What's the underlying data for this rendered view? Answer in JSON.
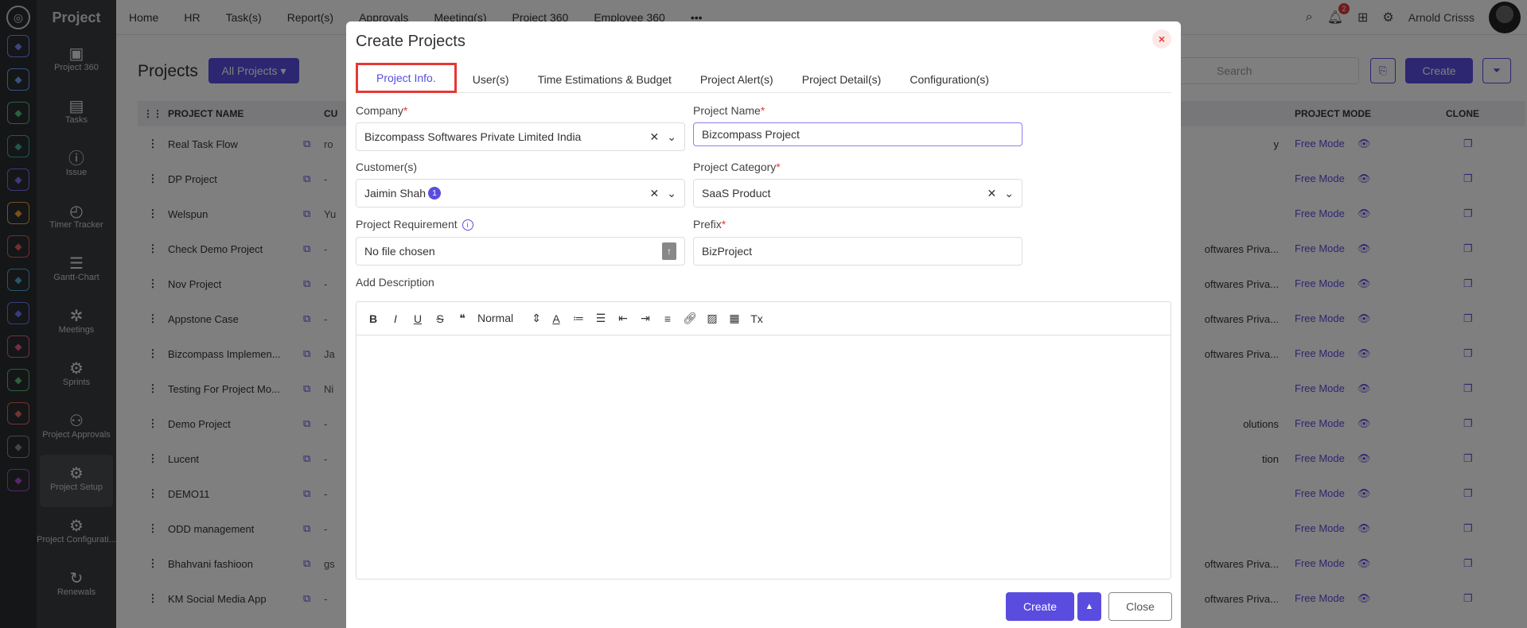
{
  "app": {
    "brand": "Project"
  },
  "rail_icons": [
    "compass-icon",
    "grid-icon",
    "pin-icon",
    "tree-icon",
    "chart-icon",
    "layers-icon",
    "people-icon",
    "target-icon",
    "calendar-icon",
    "hierarchy-icon",
    "screen-icon",
    "doc-icon",
    "spider-icon",
    "home-icon",
    "gear-icon"
  ],
  "sidebar": {
    "items": [
      {
        "label": "Project 360",
        "icon": "briefcase-icon",
        "glyph": "▣"
      },
      {
        "label": "Tasks",
        "icon": "clipboard-icon",
        "glyph": "▤"
      },
      {
        "label": "Issue",
        "icon": "alert-icon",
        "glyph": "ⓘ"
      },
      {
        "label": "Timer Tracker",
        "icon": "timer-icon",
        "glyph": "◴"
      },
      {
        "label": "Gantt-Chart",
        "icon": "gantt-icon",
        "glyph": "☰"
      },
      {
        "label": "Meetings",
        "icon": "meetings-icon",
        "glyph": "✲"
      },
      {
        "label": "Sprints",
        "icon": "sprints-icon",
        "glyph": "⚙"
      },
      {
        "label": "Project Approvals",
        "icon": "approvals-icon",
        "glyph": "⚇"
      },
      {
        "label": "Project Setup",
        "icon": "setup-icon",
        "glyph": "⚙"
      },
      {
        "label": "Project Configurati...",
        "icon": "config-icon",
        "glyph": "⚙"
      },
      {
        "label": "Renewals",
        "icon": "renew-icon",
        "glyph": "↻"
      }
    ]
  },
  "topnav": {
    "items": [
      "Home",
      "HR",
      "Task(s)",
      "Report(s)",
      "Approvals",
      "Meeting(s)",
      "Project 360",
      "Employee 360"
    ],
    "more": "•••",
    "notif_count": "2",
    "user": "Arnold Crisss"
  },
  "page": {
    "title": "Projects",
    "filter_button": "All Projects ▾",
    "search_placeholder": "Search",
    "create_label": "Create"
  },
  "table": {
    "headers": {
      "name": "PROJECT NAME",
      "cu": "CU",
      "mode": "PROJECT MODE",
      "clone": "CLONE"
    },
    "rows": [
      {
        "name": "Real Task Flow",
        "cust": "ro",
        "mid": "y",
        "mode": "Free Mode"
      },
      {
        "name": "DP Project",
        "cust": "-",
        "mid": "",
        "mode": "Free Mode"
      },
      {
        "name": "Welspun",
        "cust": "Yu",
        "mid": "",
        "mode": "Free Mode"
      },
      {
        "name": "Check Demo Project",
        "cust": "-",
        "mid": "oftwares Priva...",
        "mode": "Free Mode"
      },
      {
        "name": "Nov Project",
        "cust": "-",
        "mid": "oftwares Priva...",
        "mode": "Free Mode"
      },
      {
        "name": "Appstone Case",
        "cust": "-",
        "mid": "oftwares Priva...",
        "mode": "Free Mode"
      },
      {
        "name": "Bizcompass Implemen...",
        "cust": "Ja",
        "mid": "oftwares Priva...",
        "mode": "Free Mode"
      },
      {
        "name": "Testing For Project Mo...",
        "cust": "Ni",
        "mid": "",
        "mode": "Free Mode"
      },
      {
        "name": "Demo Project",
        "cust": "-",
        "mid": "olutions",
        "mode": "Free Mode"
      },
      {
        "name": "Lucent",
        "cust": "-",
        "mid": "tion",
        "mode": "Free Mode"
      },
      {
        "name": "DEMO11",
        "cust": "-",
        "mid": "",
        "mode": "Free Mode"
      },
      {
        "name": "ODD management",
        "cust": "-",
        "mid": "",
        "mode": "Free Mode"
      },
      {
        "name": "Bhahvani fashioon",
        "cust": "gs",
        "mid": "oftwares Priva...",
        "mode": "Free Mode"
      },
      {
        "name": "KM Social Media App",
        "cust": "-",
        "mid": "oftwares Priva...",
        "mode": "Free Mode"
      }
    ]
  },
  "modal": {
    "title": "Create Projects",
    "tabs": [
      "Project Info.",
      "User(s)",
      "Time Estimations & Budget",
      "Project Alert(s)",
      "Project Detail(s)",
      "Configuration(s)"
    ],
    "fields": {
      "company_label": "Company",
      "company_value": "Bizcompass Softwares Private Limited India",
      "project_name_label": "Project Name",
      "project_name_value": "Bizcompass Project",
      "customers_label": "Customer(s)",
      "customers_value": "Jaimin Shah",
      "customers_count": "1",
      "category_label": "Project Category",
      "category_value": "SaaS Product",
      "requirement_label": "Project Requirement",
      "requirement_value": "No file chosen",
      "prefix_label": "Prefix",
      "prefix_value": "BizProject",
      "description_label": "Add Description"
    },
    "editor": {
      "format": "Normal"
    },
    "buttons": {
      "create": "Create",
      "close": "Close"
    }
  },
  "colors": {
    "accent": "#5b4ce0",
    "danger": "#e53935",
    "overlay": "rgba(0,0,0,0.5)"
  }
}
